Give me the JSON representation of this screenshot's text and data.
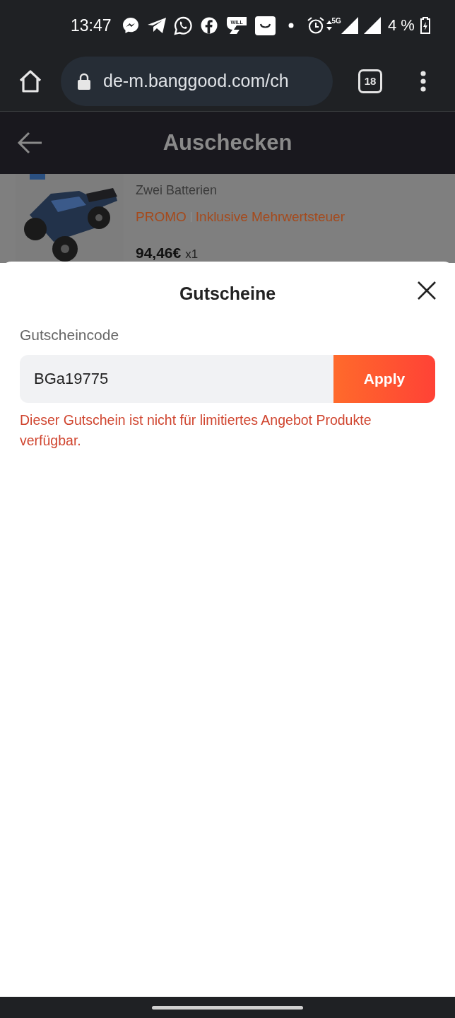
{
  "status_bar": {
    "time": "13:47",
    "app_icon_text": "WILL",
    "network": "5G",
    "battery": "4 %"
  },
  "browser": {
    "url": "de-m.banggood.com/ch",
    "tab_count": "18"
  },
  "header": {
    "title": "Auschecken"
  },
  "product": {
    "kind": "picture",
    "variant": "Zwei Batterien",
    "promo": "PROMO",
    "tax_note": "Inklusive Mehrwertsteuer",
    "price": "94,46€",
    "quantity": "x1"
  },
  "coupon_sheet": {
    "title": "Gutscheine",
    "field_label": "Gutscheincode",
    "code": "BGa19775",
    "apply": "Apply",
    "error": "Dieser Gutschein ist nicht für limitiertes Angebot Produkte verfügbar."
  }
}
